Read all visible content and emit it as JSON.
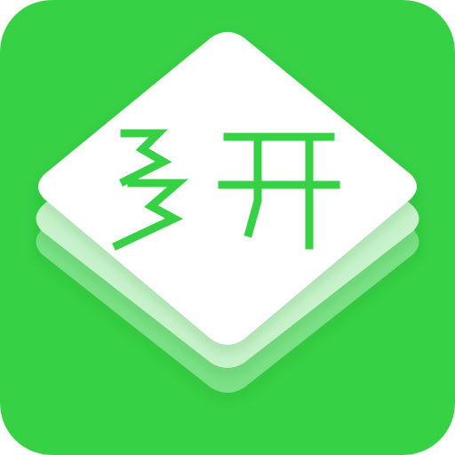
{
  "icon": {
    "logo_text": "多开",
    "icon_name": "stacked-layers-app-icon"
  },
  "colors": {
    "background": "#37D146",
    "front_layer": "#FFFFFF",
    "middle_layer": "#C8F2CC",
    "back_layer": "#7FE28A",
    "glyph": "#37D146"
  }
}
